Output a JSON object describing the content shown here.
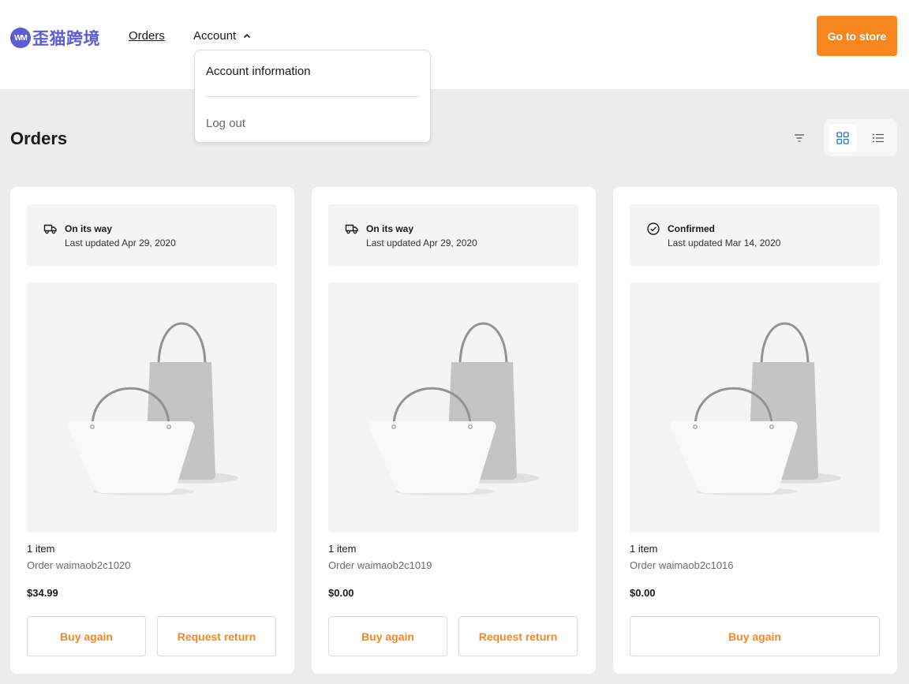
{
  "header": {
    "logo_mark": "WM",
    "logo_text": "歪猫跨境",
    "nav_orders": "Orders",
    "nav_account": "Account",
    "store_button": "Go to store"
  },
  "account_menu": {
    "account_info": "Account information",
    "logout": "Log out"
  },
  "page": {
    "title": "Orders"
  },
  "orders": [
    {
      "status": "On its way",
      "status_icon": "truck-icon",
      "updated": "Last updated Apr 29, 2020",
      "items": "1 item",
      "order_no": "Order waimaob2c1020",
      "price": "$34.99",
      "buy_again": "Buy again",
      "request_return": "Request return"
    },
    {
      "status": "On its way",
      "status_icon": "truck-icon",
      "updated": "Last updated Apr 29, 2020",
      "items": "1 item",
      "order_no": "Order waimaob2c1019",
      "price": "$0.00",
      "buy_again": "Buy again",
      "request_return": "Request return"
    },
    {
      "status": "Confirmed",
      "status_icon": "check-circle-icon",
      "updated": "Last updated Mar 14, 2020",
      "items": "1 item",
      "order_no": "Order waimaob2c1016",
      "price": "$0.00",
      "buy_again": "Buy again"
    }
  ],
  "colors": {
    "accent": "#f7861e",
    "brand": "#5d5bd6",
    "view_active": "#1a73c9"
  }
}
